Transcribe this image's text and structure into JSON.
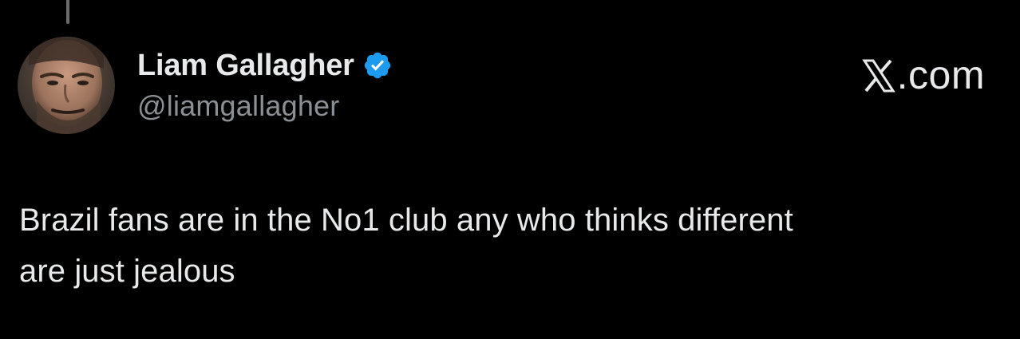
{
  "author": {
    "display_name": "Liam Gallagher",
    "handle": "@liamgallagher",
    "verified": true,
    "verified_badge_icon": "verified-check-icon",
    "avatar_icon": "profile-photo-avatar"
  },
  "brand": {
    "logo_icon": "x-logo-icon",
    "suffix": ".com"
  },
  "tweet": {
    "text_lines": [
      "Brazil fans are in the No1 club any who thinks different",
      "are just jealous"
    ]
  },
  "colors": {
    "background": "#000000",
    "primary_text": "#e7e9ea",
    "secondary_text": "#8b9096",
    "verified_blue": "#1d9bf0",
    "thread_line": "#6b6b6b"
  }
}
